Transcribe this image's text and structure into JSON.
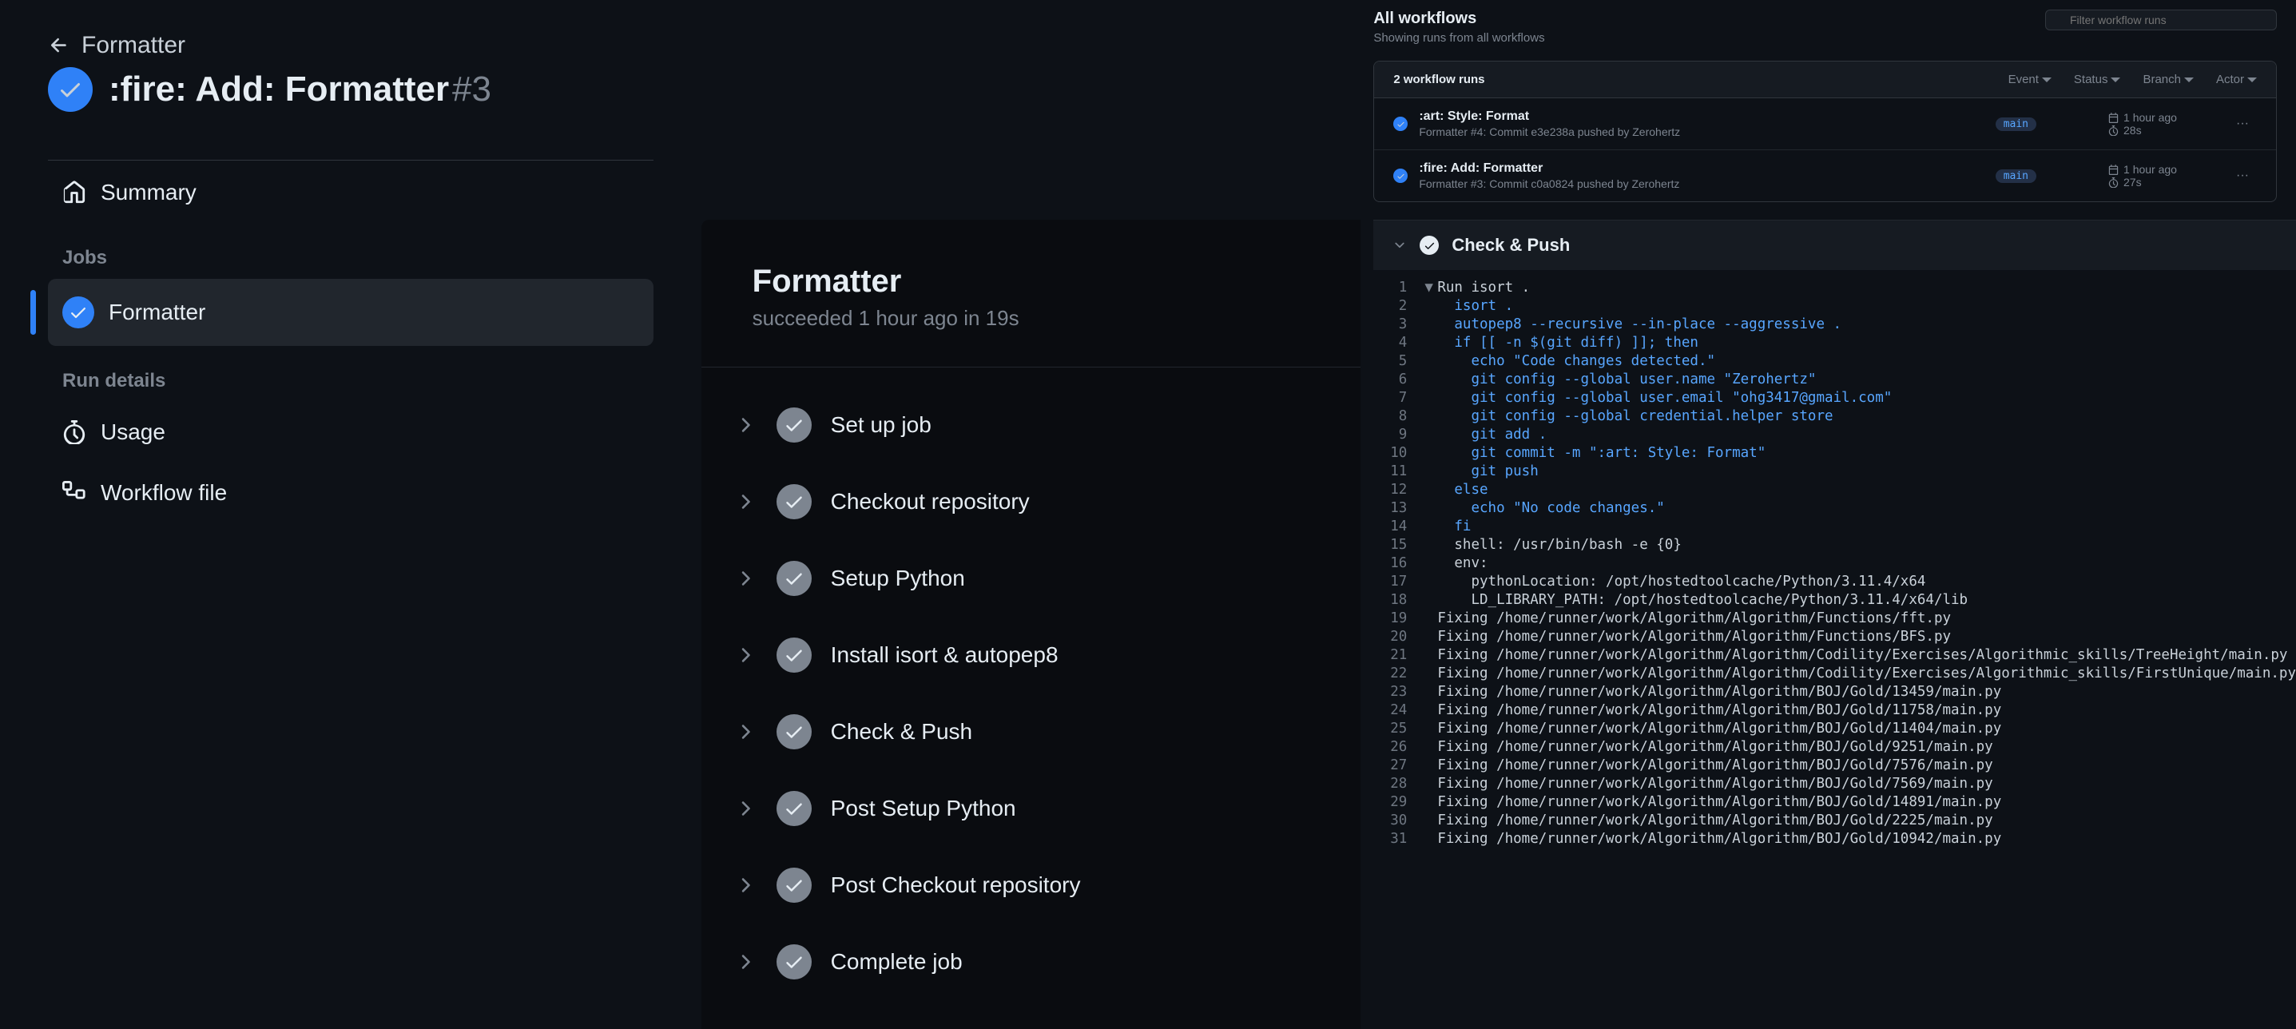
{
  "breadcrumb": {
    "workflow": "Formatter"
  },
  "run": {
    "title": ":fire: Add: Formatter",
    "number": "#3"
  },
  "sidenav": {
    "summary": "Summary",
    "jobs_heading": "Jobs",
    "job_name": "Formatter",
    "run_details_heading": "Run details",
    "usage": "Usage",
    "workflow_file": "Workflow file"
  },
  "job_panel": {
    "title": "Formatter",
    "status_line": "succeeded 1 hour ago in 19s",
    "steps": [
      "Set up job",
      "Checkout repository",
      "Setup Python",
      "Install isort & autopep8",
      "Check & Push",
      "Post Setup Python",
      "Post Checkout repository",
      "Complete job"
    ]
  },
  "workflows_header": {
    "title": "All workflows",
    "subtitle": "Showing runs from all workflows",
    "filter_placeholder": "Filter workflow runs"
  },
  "runs_table": {
    "count_label": "2 workflow runs",
    "filters": [
      "Event",
      "Status",
      "Branch",
      "Actor"
    ],
    "rows": [
      {
        "title": ":art: Style: Format",
        "sub": "Formatter #4: Commit e3e238a pushed by Zerohertz",
        "branch": "main",
        "time": "1 hour ago",
        "dur": "28s"
      },
      {
        "title": ":fire: Add: Formatter",
        "sub": "Formatter #3: Commit c0a0824 pushed by Zerohertz",
        "branch": "main",
        "time": "1 hour ago",
        "dur": "27s"
      }
    ]
  },
  "log": {
    "header": "Check & Push",
    "lines": [
      {
        "n": 1,
        "tri": true,
        "cls": "plain",
        "t": "Run isort ."
      },
      {
        "n": 2,
        "cls": "cmd",
        "t": "  isort ."
      },
      {
        "n": 3,
        "cls": "cmd",
        "t": "  autopep8 --recursive --in-place --aggressive ."
      },
      {
        "n": 4,
        "cls": "cmd",
        "t": "  if [[ -n $(git diff) ]]; then"
      },
      {
        "n": 5,
        "cls": "cmd",
        "t": "    echo \"Code changes detected.\""
      },
      {
        "n": 6,
        "cls": "cmd",
        "t": "    git config --global user.name \"Zerohertz\""
      },
      {
        "n": 7,
        "cls": "cmd",
        "t": "    git config --global user.email \"ohg3417@gmail.com\""
      },
      {
        "n": 8,
        "cls": "cmd",
        "t": "    git config --global credential.helper store"
      },
      {
        "n": 9,
        "cls": "cmd",
        "t": "    git add ."
      },
      {
        "n": 10,
        "cls": "cmd",
        "t": "    git commit -m \":art: Style: Format\""
      },
      {
        "n": 11,
        "cls": "cmd",
        "t": "    git push"
      },
      {
        "n": 12,
        "cls": "cmd",
        "t": "  else"
      },
      {
        "n": 13,
        "cls": "cmd",
        "t": "    echo \"No code changes.\""
      },
      {
        "n": 14,
        "cls": "cmd",
        "t": "  fi"
      },
      {
        "n": 15,
        "cls": "plain",
        "t": "  shell: /usr/bin/bash -e {0}"
      },
      {
        "n": 16,
        "cls": "plain",
        "t": "  env:"
      },
      {
        "n": 17,
        "cls": "plain",
        "t": "    pythonLocation: /opt/hostedtoolcache/Python/3.11.4/x64"
      },
      {
        "n": 18,
        "cls": "plain",
        "t": "    LD_LIBRARY_PATH: /opt/hostedtoolcache/Python/3.11.4/x64/lib"
      },
      {
        "n": 19,
        "cls": "plain",
        "t": "Fixing /home/runner/work/Algorithm/Algorithm/Functions/fft.py"
      },
      {
        "n": 20,
        "cls": "plain",
        "t": "Fixing /home/runner/work/Algorithm/Algorithm/Functions/BFS.py"
      },
      {
        "n": 21,
        "cls": "plain",
        "t": "Fixing /home/runner/work/Algorithm/Algorithm/Codility/Exercises/Algorithmic_skills/TreeHeight/main.py"
      },
      {
        "n": 22,
        "cls": "plain",
        "t": "Fixing /home/runner/work/Algorithm/Algorithm/Codility/Exercises/Algorithmic_skills/FirstUnique/main.py"
      },
      {
        "n": 23,
        "cls": "plain",
        "t": "Fixing /home/runner/work/Algorithm/Algorithm/BOJ/Gold/13459/main.py"
      },
      {
        "n": 24,
        "cls": "plain",
        "t": "Fixing /home/runner/work/Algorithm/Algorithm/BOJ/Gold/11758/main.py"
      },
      {
        "n": 25,
        "cls": "plain",
        "t": "Fixing /home/runner/work/Algorithm/Algorithm/BOJ/Gold/11404/main.py"
      },
      {
        "n": 26,
        "cls": "plain",
        "t": "Fixing /home/runner/work/Algorithm/Algorithm/BOJ/Gold/9251/main.py"
      },
      {
        "n": 27,
        "cls": "plain",
        "t": "Fixing /home/runner/work/Algorithm/Algorithm/BOJ/Gold/7576/main.py"
      },
      {
        "n": 28,
        "cls": "plain",
        "t": "Fixing /home/runner/work/Algorithm/Algorithm/BOJ/Gold/7569/main.py"
      },
      {
        "n": 29,
        "cls": "plain",
        "t": "Fixing /home/runner/work/Algorithm/Algorithm/BOJ/Gold/14891/main.py"
      },
      {
        "n": 30,
        "cls": "plain",
        "t": "Fixing /home/runner/work/Algorithm/Algorithm/BOJ/Gold/2225/main.py"
      },
      {
        "n": 31,
        "cls": "plain",
        "t": "Fixing /home/runner/work/Algorithm/Algorithm/BOJ/Gold/10942/main.py"
      }
    ]
  }
}
